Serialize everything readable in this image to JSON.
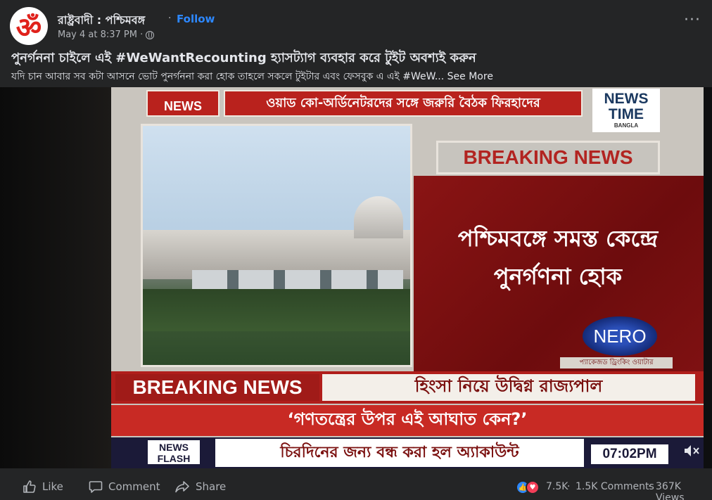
{
  "post": {
    "page_name": "রাষ্ট্রবাদী : পশ্চিমবঙ্গ",
    "avatar_symbol": "ॐ",
    "follow_label": "Follow",
    "follow_separator": "·",
    "timestamp": "May 4 at 8:37 PM ·",
    "more_label": "···",
    "title": "পুনর্গননা চাইলে এই #WeWantRecounting হ্যাসট্যাগ ব্যবহার করে টুইট অবশ্যই করুন",
    "text": "যদি চান আবার সব কটা আসনে ভোট পুনর্গননা করা হোক তাহলে সকলে টুইটার এবং ফেসবুক এ এই #WeW...",
    "see_more": "See More"
  },
  "video": {
    "top_logo": "NEWS",
    "top_headline": "ওয়াড কো-অর্ডিনেটরদের সঙ্গে জরুরি বৈঠক ফিরহাদের",
    "channel_line1": "NEWS",
    "channel_line2": "TIME",
    "channel_line3": "BANGLA",
    "breaking_top_a": "BREAKING",
    "breaking_top_b": "NEWS",
    "red_panel_text": "পশ্চিমবঙ্গে সমস্ত কেন্দ্রে পুনর্গণনা হোক",
    "watermark": "NERO",
    "caption": "প্যাকেজড ড্রিংকিং ওয়াটার",
    "breaking_label": "BREAKING NEWS",
    "breaking_headline": "হিংসা নিয়ে উদ্বিগ্ন রাজ্যপাল",
    "quote": "‘গণতন্ত্রের উপর এই আঘাত কেন?’",
    "flash_line1": "NEWS",
    "flash_line2": "FLASH",
    "ticker": "চিরদিনের জন্য বন্ধ করা হল অ্যাকাউন্ট",
    "clock": "07:02PM"
  },
  "actions": {
    "like_label": "Like",
    "comment_label": "Comment",
    "share_label": "Share",
    "reactions_count": "7.5K",
    "comments_count": "1.5K Comments",
    "views_count": "367K Views",
    "stat_separator": "·"
  },
  "colors": {
    "background": "#242526",
    "link_blue": "#2d88ff",
    "secondary_text": "#b0b3b8",
    "tv_red": "#b01e1b"
  },
  "icons": {
    "globe": "globe-icon",
    "like": "thumbs-up-icon",
    "comment": "speech-bubble-icon",
    "share": "share-arrow-icon",
    "mute": "speaker-muted-icon",
    "more": "more-horizontal-icon"
  }
}
